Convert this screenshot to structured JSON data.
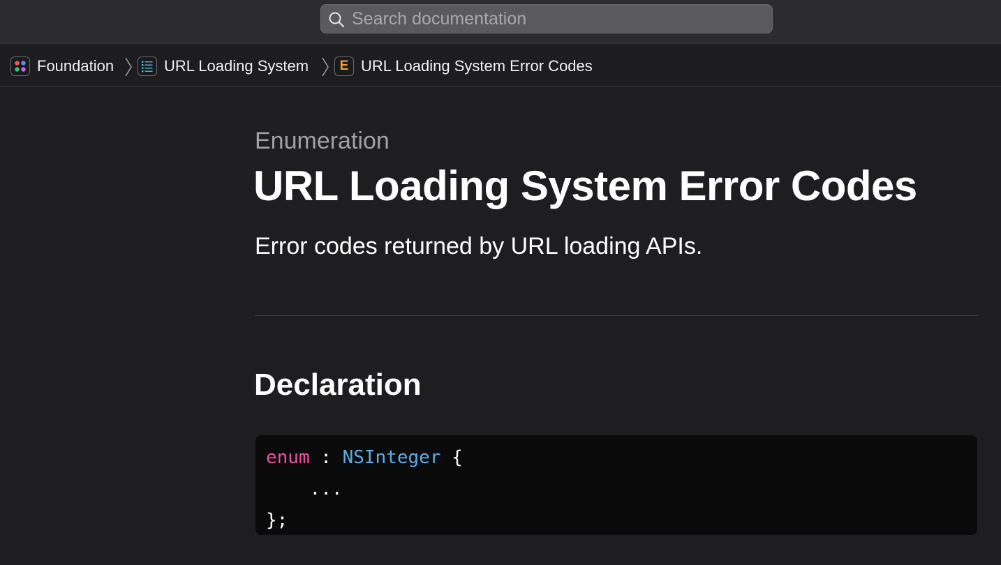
{
  "search": {
    "placeholder": "Search documentation",
    "icon": "search-icon"
  },
  "breadcrumbs": [
    {
      "label": "Foundation",
      "icon": "framework-grid-icon"
    },
    {
      "label": "URL Loading System",
      "icon": "article-list-icon"
    },
    {
      "label": "URL Loading System Error Codes",
      "icon": "enumeration-icon",
      "icon_letter": "E"
    }
  ],
  "page": {
    "kind": "Enumeration",
    "title": "URL Loading System Error Codes",
    "abstract": "Error codes returned by URL loading APIs."
  },
  "declaration": {
    "heading": "Declaration",
    "code": {
      "keyword": "enum",
      "separator": " : ",
      "type": "NSInteger",
      "open": " {",
      "body": "    ...",
      "close": "};"
    }
  },
  "colors": {
    "background": "#1e1e20",
    "toolbar": "#2c2c2e",
    "keyword": "#ef4fa0",
    "type": "#5dade8",
    "enum_icon": "#f0a030",
    "framework_dots": [
      "#ef5b5b",
      "#5a8dee",
      "#36c06a",
      "#b86be6"
    ]
  }
}
